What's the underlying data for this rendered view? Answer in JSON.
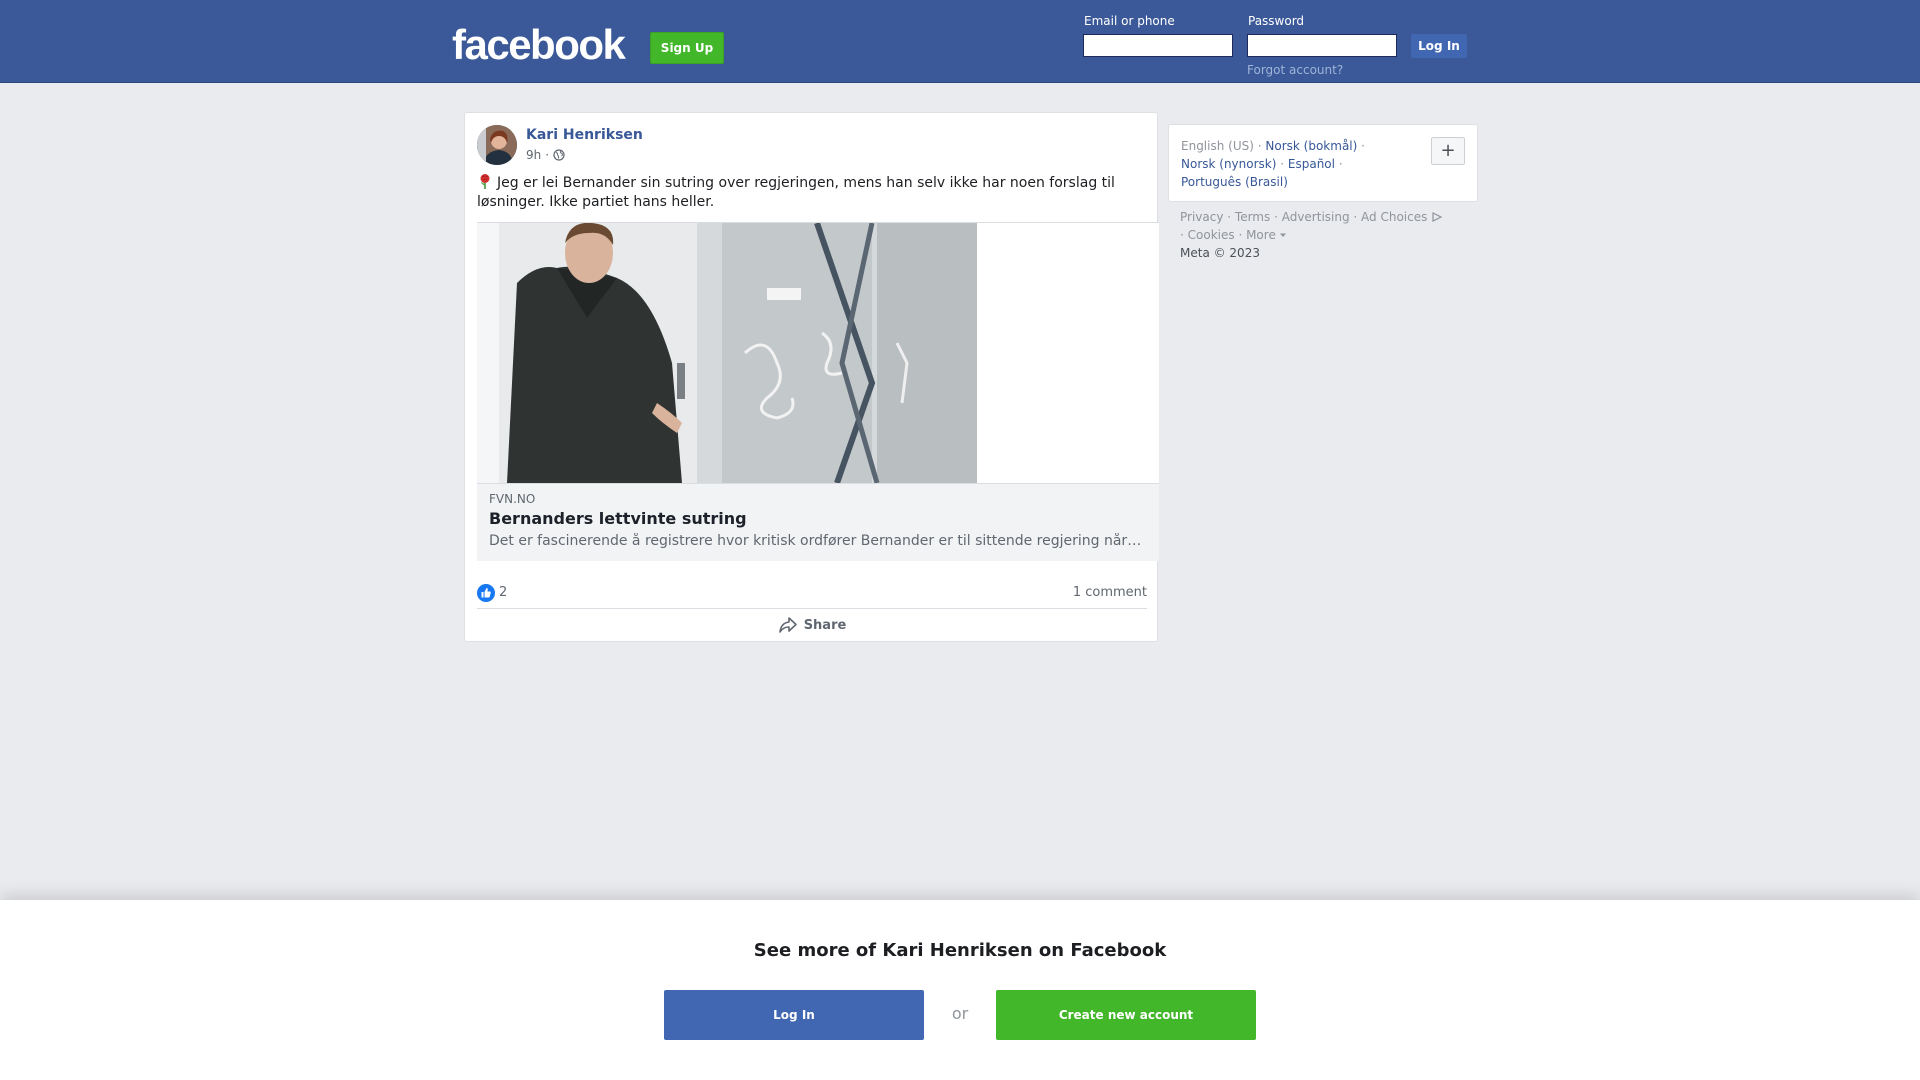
{
  "header": {
    "logo": "facebook",
    "signup_label": "Sign Up",
    "email_label": "Email or phone",
    "email_value": "",
    "password_label": "Password",
    "password_value": "",
    "login_label": "Log In",
    "forgot_label": "Forgot account?"
  },
  "post": {
    "author": "Kari Henriksen",
    "time": "9h",
    "separator": "·",
    "privacy_icon": "globe-icon",
    "emoji_icon": "rose-icon",
    "text": "Jeg er lei Bernander sin sutring over regjeringen, mens han selv ikke har noen forslag til løsninger. Ikke partiet hans heller.",
    "link": {
      "domain": "FVN.NO",
      "title": "Bernanders lettvinte sutring",
      "description": "Det er fascinerende å registrere hvor kritisk ordfører Bernander er til sittende regjering når han selv ikke har noen forslag."
    },
    "like_count": "2",
    "comment_count": "1 comment",
    "share_label": "Share"
  },
  "sidebar": {
    "languages": {
      "current": "English (US)",
      "links": [
        "Norsk (bokmål)",
        "Norsk (nynorsk)",
        "Español",
        "Português (Brasil)"
      ],
      "more_symbol": "+"
    },
    "footer": {
      "privacy": "Privacy",
      "terms": "Terms",
      "advertising": "Advertising",
      "ad_choices": "Ad Choices",
      "cookies": "Cookies",
      "more": "More",
      "copyright": "Meta © 2023"
    }
  },
  "bottom_prompt": {
    "title": "See more of Kari Henriksen on Facebook",
    "login_label": "Log In",
    "or_label": "or",
    "create_label": "Create new account"
  },
  "colors": {
    "brand_blue": "#3b5998",
    "button_blue": "#4267b2",
    "green": "#42b72a",
    "link_blue": "#385898",
    "background": "#e9ebee"
  }
}
